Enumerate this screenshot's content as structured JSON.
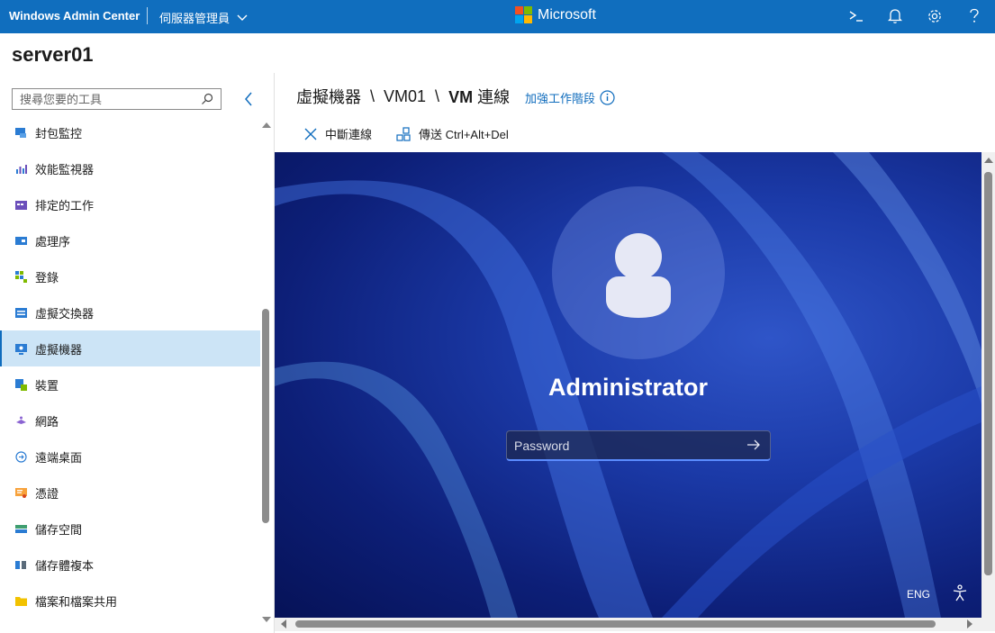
{
  "topbar": {
    "app_title": "Windows Admin Center",
    "context_menu_label": "伺服器管理員",
    "brand": "Microsoft",
    "brand_colors": [
      "#f25022",
      "#7fba00",
      "#00a4ef",
      "#ffb900"
    ],
    "icons": [
      "powershell-icon",
      "notification-bell-icon",
      "settings-gear-icon",
      "help-icon"
    ]
  },
  "server": {
    "name": "server01"
  },
  "sidebar": {
    "search_placeholder": "搜尋您要的工具",
    "items": [
      {
        "label": "封包監控",
        "icon": "packet-monitor-icon"
      },
      {
        "label": "效能監視器",
        "icon": "performance-monitor-icon"
      },
      {
        "label": "排定的工作",
        "icon": "scheduled-tasks-icon"
      },
      {
        "label": "處理序",
        "icon": "processes-icon"
      },
      {
        "label": "登錄",
        "icon": "registry-icon"
      },
      {
        "label": "虛擬交換器",
        "icon": "virtual-switch-icon"
      },
      {
        "label": "虛擬機器",
        "icon": "virtual-machine-icon",
        "active": true
      },
      {
        "label": "裝置",
        "icon": "devices-icon"
      },
      {
        "label": "網路",
        "icon": "network-icon"
      },
      {
        "label": "遠端桌面",
        "icon": "remote-desktop-icon"
      },
      {
        "label": "憑證",
        "icon": "certificates-icon"
      },
      {
        "label": "儲存空間",
        "icon": "storage-icon"
      },
      {
        "label": "儲存體複本",
        "icon": "storage-replica-icon"
      },
      {
        "label": "檔案和檔案共用",
        "icon": "files-icon"
      }
    ]
  },
  "breadcrumb": {
    "part1": "虛擬機器",
    "sep": "\\",
    "part2": "VM01",
    "part3_bold": "VM",
    "part3_rest": "連線"
  },
  "session_link": "加強工作階段",
  "toolbar": {
    "disconnect": "中斷連線",
    "send_keys": "傳送 Ctrl+Alt+Del"
  },
  "vm": {
    "username": "Administrator",
    "password_placeholder": "Password",
    "language": "ENG",
    "accent": "#5b8cff"
  }
}
